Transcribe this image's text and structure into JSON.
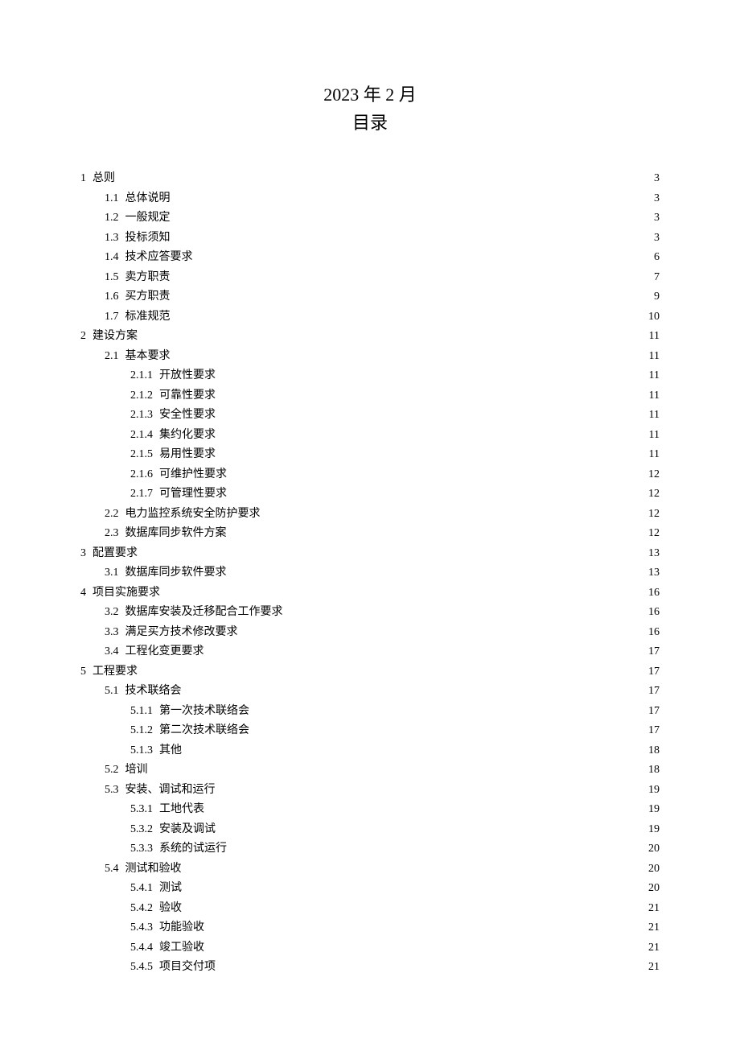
{
  "header": {
    "date": "2023 年 2 月",
    "toc_label": "目录"
  },
  "toc": [
    {
      "level": 1,
      "num": "1",
      "title": "总则",
      "page": "3"
    },
    {
      "level": 2,
      "num": "1.1",
      "title": "总体说明",
      "page": "3"
    },
    {
      "level": 2,
      "num": "1.2",
      "title": "一般规定",
      "page": "3"
    },
    {
      "level": 2,
      "num": "1.3",
      "title": "投标须知",
      "page": "3"
    },
    {
      "level": 2,
      "num": "1.4",
      "title": "技术应答要求",
      "page": "6"
    },
    {
      "level": 2,
      "num": "1.5",
      "title": "卖方职责",
      "page": "7"
    },
    {
      "level": 2,
      "num": "1.6",
      "title": "买方职责",
      "page": "9"
    },
    {
      "level": 2,
      "num": "1.7",
      "title": "标准规范",
      "page": "10"
    },
    {
      "level": 1,
      "num": "2",
      "title": "建设方案",
      "page": "11"
    },
    {
      "level": 2,
      "num": "2.1",
      "title": "基本要求",
      "page": "11"
    },
    {
      "level": 3,
      "num": "2.1.1",
      "title": "开放性要求",
      "page": "11"
    },
    {
      "level": 3,
      "num": "2.1.2",
      "title": "可靠性要求",
      "page": "11"
    },
    {
      "level": 3,
      "num": "2.1.3",
      "title": "安全性要求",
      "page": "11"
    },
    {
      "level": 3,
      "num": "2.1.4",
      "title": "集约化要求",
      "page": "11"
    },
    {
      "level": 3,
      "num": "2.1.5",
      "title": "易用性要求",
      "page": "11"
    },
    {
      "level": 3,
      "num": "2.1.6",
      "title": "可维护性要求",
      "page": "12"
    },
    {
      "level": 3,
      "num": "2.1.7",
      "title": "可管理性要求",
      "page": "12"
    },
    {
      "level": 2,
      "num": "2.2",
      "title": "电力监控系统安全防护要求",
      "page": "12"
    },
    {
      "level": 2,
      "num": "2.3",
      "title": "数据库同步软件方案",
      "page": "12"
    },
    {
      "level": 1,
      "num": "3",
      "title": "配置要求",
      "page": "13"
    },
    {
      "level": 2,
      "num": "3.1",
      "title": "数据库同步软件要求",
      "page": "13"
    },
    {
      "level": 1,
      "num": "4",
      "title": "项目实施要求",
      "page": "16"
    },
    {
      "level": 2,
      "num": "3.2",
      "title": "数据库安装及迁移配合工作要求",
      "page": "16"
    },
    {
      "level": 2,
      "num": "3.3",
      "title": "满足买方技术修改要求",
      "page": "16"
    },
    {
      "level": 2,
      "num": "3.4",
      "title": "工程化变更要求",
      "page": "17"
    },
    {
      "level": 1,
      "num": "5",
      "title": "工程要求",
      "page": "17"
    },
    {
      "level": 2,
      "num": "5.1",
      "title": "技术联络会",
      "page": "17"
    },
    {
      "level": 3,
      "num": "5.1.1",
      "title": "第一次技术联络会",
      "page": "17"
    },
    {
      "level": 3,
      "num": "5.1.2",
      "title": "第二次技术联络会",
      "page": "17"
    },
    {
      "level": 3,
      "num": "5.1.3",
      "title": "其他",
      "page": "18"
    },
    {
      "level": 2,
      "num": "5.2",
      "title": "培训",
      "page": "18"
    },
    {
      "level": 2,
      "num": "5.3",
      "title": "安装、调试和运行",
      "page": "19"
    },
    {
      "level": 3,
      "num": "5.3.1",
      "title": "工地代表",
      "page": "19"
    },
    {
      "level": 3,
      "num": "5.3.2",
      "title": "安装及调试",
      "page": "19"
    },
    {
      "level": 3,
      "num": "5.3.3",
      "title": "系统的试运行",
      "page": "20"
    },
    {
      "level": 2,
      "num": "5.4",
      "title": "测试和验收",
      "page": "20"
    },
    {
      "level": 3,
      "num": "5.4.1",
      "title": "测试",
      "page": "20"
    },
    {
      "level": 3,
      "num": "5.4.2",
      "title": "验收",
      "page": "21"
    },
    {
      "level": 3,
      "num": "5.4.3",
      "title": "功能验收",
      "page": "21"
    },
    {
      "level": 3,
      "num": "5.4.4",
      "title": "竣工验收",
      "page": "21"
    },
    {
      "level": 3,
      "num": "5.4.5",
      "title": "项目交付项",
      "page": "21"
    }
  ]
}
